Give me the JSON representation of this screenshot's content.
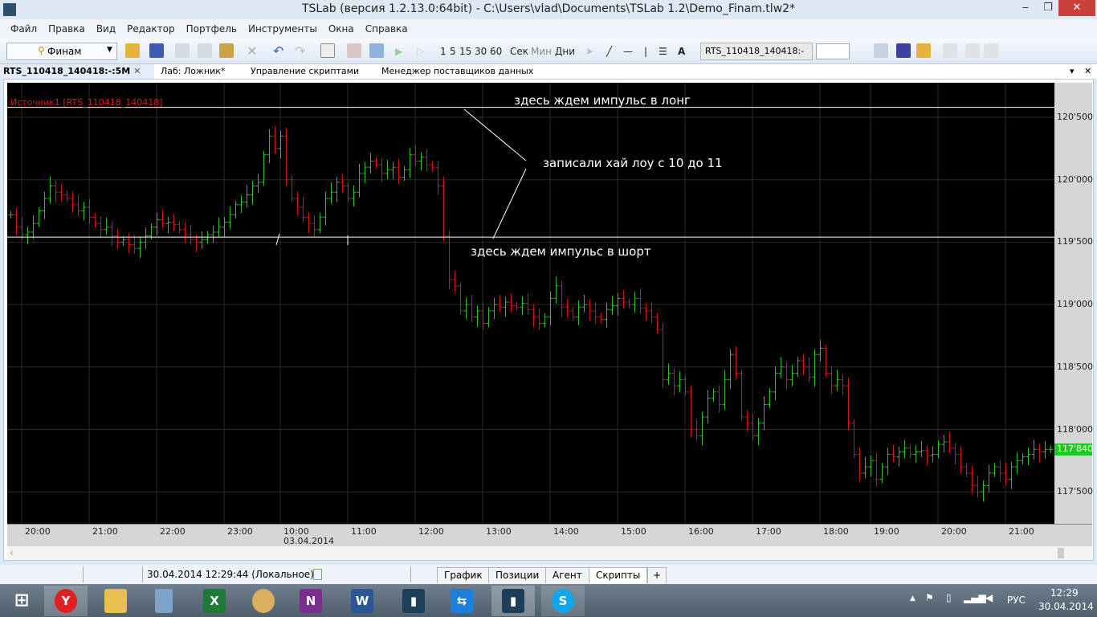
{
  "window": {
    "title": "TSLab (версия 1.2.13.0:64bit) - C:\\Users\\vlad\\Documents\\TSLab 1.2\\Demo_Finam.tlw2*",
    "minimize": "‒",
    "restore": "❐",
    "close": "✕"
  },
  "menu": [
    "Файл",
    "Правка",
    "Вид",
    "Редактор",
    "Портфель",
    "Инструменты",
    "Окна",
    "Справка"
  ],
  "toolbar": {
    "provider": "Финам",
    "intervals": [
      "1",
      "5",
      "15",
      "30",
      "60"
    ],
    "units": [
      "Сек",
      "Мин",
      "Дни"
    ],
    "symbol_select": "RTS_110418_140418:-"
  },
  "doc_tabs": [
    {
      "label": "RTS_110418_140418:-:5M",
      "active": true
    },
    {
      "label": "Лаб: Ложник*"
    },
    {
      "label": "Управление скриптами"
    },
    {
      "label": "Менеджер поставщиков данных"
    }
  ],
  "chart_data": {
    "type": "ohlc",
    "source_label": "Источник1 [RTS_110418_140418]",
    "ylim": [
      117250,
      120850
    ],
    "y_ticks": [
      120500,
      120000,
      119500,
      119000,
      118500,
      118000,
      117500
    ],
    "y_tick_labels": [
      "120'500",
      "120'000",
      "119'500",
      "119'000",
      "118'500",
      "118'000",
      "117'500"
    ],
    "last_price": 117840,
    "last_price_label": "117'840",
    "x_ticks": [
      {
        "label": "20:00",
        "bar": 2
      },
      {
        "label": "21:00",
        "bar": 14
      },
      {
        "label": "22:00",
        "bar": 26
      },
      {
        "label": "23:00",
        "bar": 38
      },
      {
        "label": "10:00",
        "bar": 48,
        "sub": "03.04.2014"
      },
      {
        "label": "11:00",
        "bar": 60
      },
      {
        "label": "12:00",
        "bar": 72
      },
      {
        "label": "13:00",
        "bar": 84
      },
      {
        "label": "14:00",
        "bar": 96
      },
      {
        "label": "15:00",
        "bar": 108
      },
      {
        "label": "16:00",
        "bar": 120
      },
      {
        "label": "17:00",
        "bar": 132
      },
      {
        "label": "18:00",
        "bar": 144
      },
      {
        "label": "19:00",
        "bar": 153
      },
      {
        "label": "20:00",
        "bar": 165
      },
      {
        "label": "21:00",
        "bar": 177
      }
    ],
    "closes": [
      119720,
      119620,
      119560,
      119580,
      119650,
      119750,
      119850,
      119950,
      119900,
      119880,
      119850,
      119800,
      119750,
      119780,
      119700,
      119650,
      119600,
      119620,
      119550,
      119500,
      119520,
      119480,
      119450,
      119500,
      119550,
      119620,
      119680,
      119650,
      119660,
      119640,
      119600,
      119560,
      119520,
      119500,
      119520,
      119560,
      119580,
      119620,
      119660,
      119720,
      119800,
      119820,
      119880,
      119950,
      119980,
      120200,
      120350,
      120250,
      120350,
      120000,
      119850,
      119780,
      119700,
      119650,
      119600,
      119700,
      119850,
      119900,
      119980,
      119950,
      119850,
      119900,
      120050,
      120100,
      120150,
      120120,
      120050,
      120080,
      120100,
      120020,
      120080,
      120200,
      120150,
      120180,
      120120,
      120100,
      119950,
      119550,
      119200,
      119150,
      118950,
      119000,
      118900,
      118950,
      118850,
      118950,
      119000,
      118980,
      119020,
      118990,
      118980,
      119010,
      118960,
      118900,
      118850,
      118900,
      119050,
      119150,
      118980,
      118950,
      118900,
      118980,
      119000,
      118950,
      118900,
      118880,
      118960,
      118990,
      119050,
      119020,
      119000,
      119050,
      118970,
      118950,
      118900,
      118800,
      118400,
      118450,
      118350,
      118400,
      118300,
      118000,
      117950,
      118100,
      118250,
      118300,
      118200,
      118400,
      118600,
      118450,
      118100,
      118050,
      117950,
      118050,
      118200,
      118300,
      118450,
      118500,
      118400,
      118450,
      118550,
      118500,
      118420,
      118600,
      118650,
      118450,
      118350,
      118400,
      118350,
      118050,
      117800,
      117650,
      117700,
      117750,
      117600,
      117700,
      117800,
      117780,
      117820,
      117850,
      117800,
      117820,
      117830,
      117790,
      117800,
      117880,
      117900,
      117850,
      117800,
      117700,
      117650,
      117550,
      117500,
      117550,
      117650,
      117700,
      117650,
      117600,
      117700,
      117750,
      117780,
      117800,
      117840,
      117820,
      117840,
      117840
    ],
    "hlines": [
      120580,
      119540
    ],
    "annotations": [
      "здесь ждем импульс в лонг",
      "записали хай лоу с 10 до 11",
      "здесь ждем импульс в шорт"
    ],
    "colors": {
      "up": "#2fbf2f",
      "down": "#d01818",
      "grid": "#2a2a2a",
      "hline": "#ffffff",
      "last": "#22c822"
    }
  },
  "status": {
    "datetime": "30.04.2014 12:29:44 (Локальное)",
    "tabs": [
      "График",
      "Позиции",
      "Агент",
      "Скрипты"
    ],
    "active_tab": "Скрипты",
    "add": "+"
  },
  "taskbar": {
    "apps": [
      "start",
      "yandex-browser",
      "file-explorer",
      "calculator",
      "excel",
      "paint",
      "onenote",
      "word",
      "tslab",
      "teamviewer",
      "tslab",
      "skype"
    ],
    "lang": "РУС",
    "time": "12:29",
    "date": "30.04.2014"
  }
}
